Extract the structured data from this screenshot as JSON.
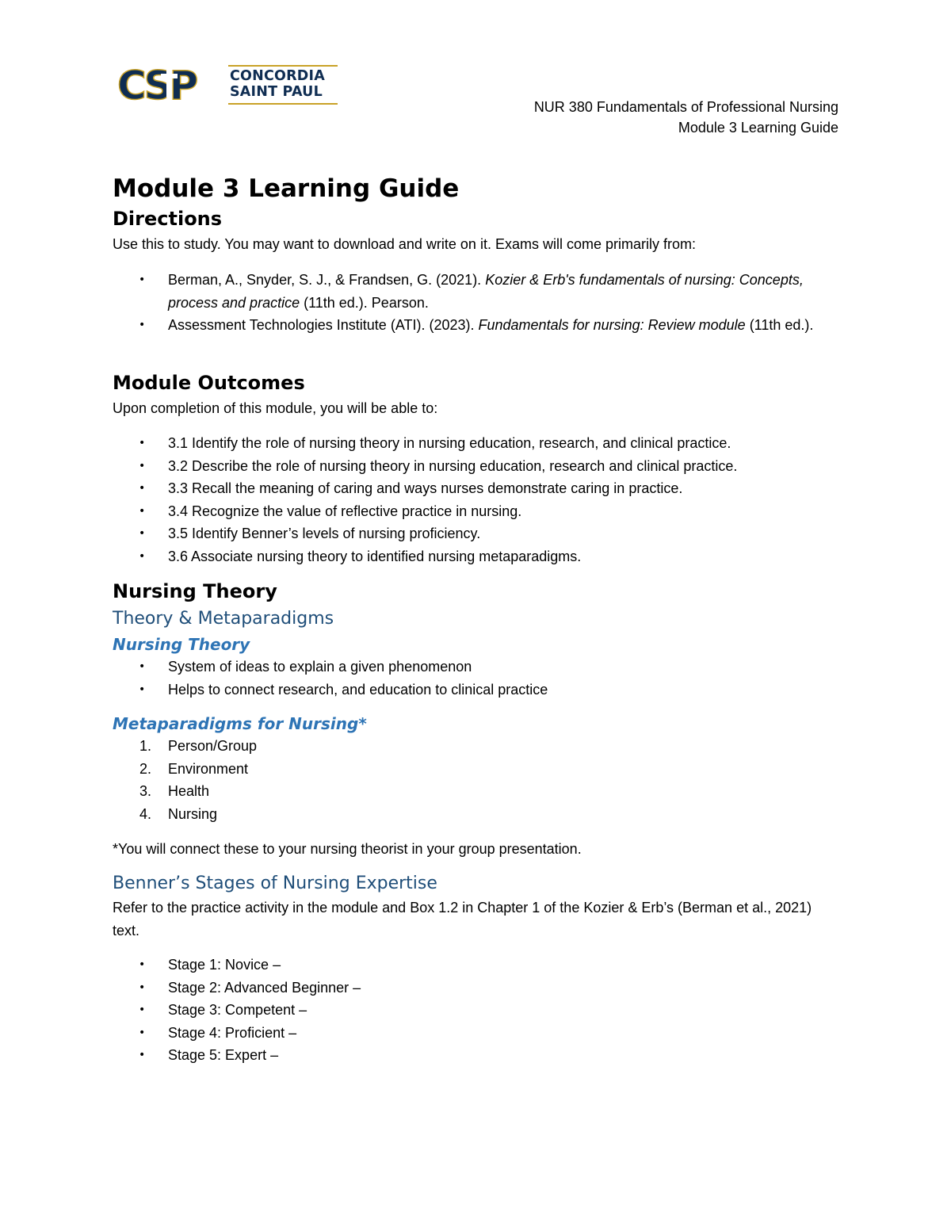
{
  "logo": {
    "monogram": "CSP",
    "name_line1": "CONCORDIA",
    "name_line2": "SAINT PAUL",
    "colors": {
      "navy": "#0f2d52",
      "gold": "#c9a227"
    }
  },
  "running_header": {
    "line1": "NUR 380 Fundamentals of Professional Nursing",
    "line2": "Module 3 Learning Guide"
  },
  "title": "Module 3 Learning Guide",
  "directions": {
    "heading": "Directions",
    "intro": "Use this to study. You may want to download and write on it. Exams will come primarily from:",
    "references": [
      {
        "prefix": "Berman, A., Snyder, S. J., & Frandsen, G. (2021). ",
        "italic": "Kozier & Erb's fundamentals of nursing: Concepts, process and practice",
        "suffix": " (11th ed.). Pearson."
      },
      {
        "prefix": "Assessment Technologies Institute (ATI). (2023). ",
        "italic": "Fundamentals for nursing: Review module",
        "suffix": " (11th ed.)."
      }
    ]
  },
  "outcomes": {
    "heading": "Module Outcomes",
    "intro": "Upon completion of this module, you will be able to:",
    "items": [
      "3.1 Identify the role of nursing theory in nursing education, research, and clinical practice.",
      "3.2 Describe the role of nursing theory in nursing education, research and clinical practice.",
      "3.3 Recall the meaning of caring and ways nurses demonstrate caring in practice.",
      "3.4 Recognize the value of reflective practice in nursing.",
      "3.5 Identify Benner’s levels of nursing proficiency.",
      "3.6 Associate nursing theory to identified nursing metaparadigms."
    ]
  },
  "nursing_theory": {
    "heading": "Nursing Theory",
    "subheading": "Theory & Metaparadigms",
    "theory": {
      "heading": "Nursing Theory",
      "items": [
        "System of ideas to explain a given phenomenon",
        "Helps to connect research, and education to clinical practice"
      ]
    },
    "metaparadigms": {
      "heading": "Metaparadigms for Nursing*",
      "items": [
        {
          "num": "1.",
          "label": "Person/Group"
        },
        {
          "num": "2.",
          "label": "Environment"
        },
        {
          "num": "3.",
          "label": "Health"
        },
        {
          "num": "4.",
          "label": "Nursing"
        }
      ],
      "footnote": "*You will connect these to your nursing theorist in your group presentation."
    },
    "benner": {
      "heading": "Benner’s Stages of Nursing Expertise",
      "intro": "Refer to the practice activity in the module and Box 1.2 in Chapter 1 of the Kozier & Erb’s (Berman et al., 2021) text.",
      "stages": [
        "Stage 1: Novice –",
        "Stage 2: Advanced Beginner –",
        "Stage 3: Competent –",
        "Stage 4: Proficient –",
        "Stage 5: Expert –"
      ]
    }
  },
  "bullet_glyph": "•"
}
